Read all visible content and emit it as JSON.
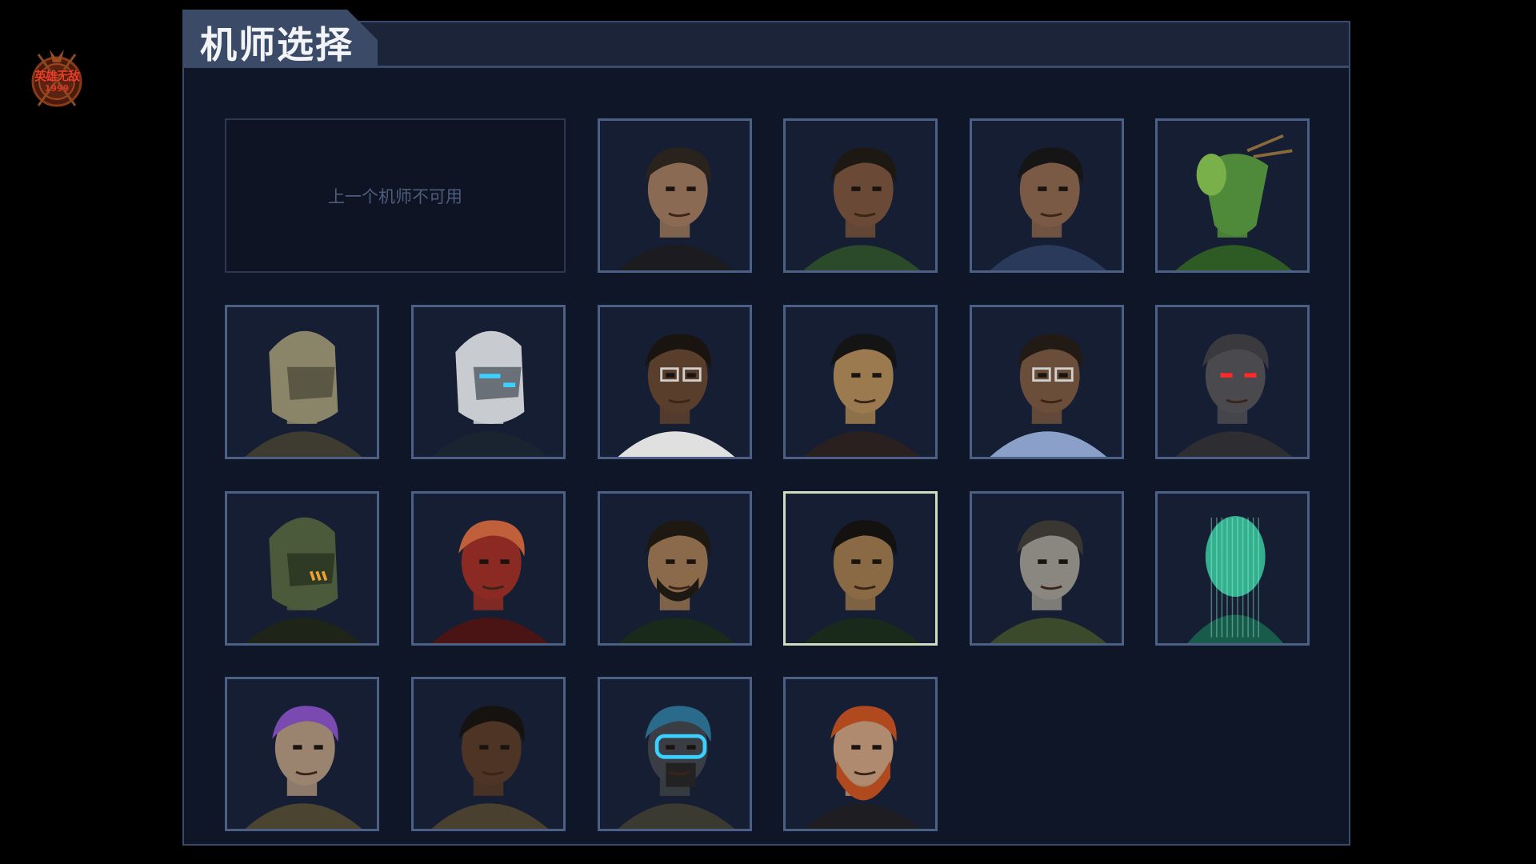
{
  "screen": {
    "title": "机师选择",
    "unavailable_label": "上一个机师不可用",
    "logo_text": "英雄无敌",
    "logo_year": "1999"
  },
  "pilots": [
    {
      "icon": "older-man-stubble-portrait-icon",
      "selected": false
    },
    {
      "icon": "young-woman-portrait-icon",
      "selected": false
    },
    {
      "icon": "curly-haired-youth-portrait-icon",
      "selected": false
    },
    {
      "icon": "mantis-alien-portrait-icon",
      "selected": false
    },
    {
      "icon": "tan-helmet-portrait-icon",
      "selected": false
    },
    {
      "icon": "white-cyan-helmet-portrait-icon",
      "selected": false
    },
    {
      "icon": "man-glasses-portrait-icon",
      "selected": false
    },
    {
      "icon": "smiling-man-portrait-icon",
      "selected": false
    },
    {
      "icon": "woman-glasses-portrait-icon",
      "selected": false
    },
    {
      "icon": "stone-golem-red-eyes-portrait-icon",
      "selected": false
    },
    {
      "icon": "green-insect-helmet-portrait-icon",
      "selected": false
    },
    {
      "icon": "red-armored-helmet-portrait-icon",
      "selected": false
    },
    {
      "icon": "bearded-scarred-man-portrait-icon",
      "selected": false
    },
    {
      "icon": "smiling-woman-portrait-icon",
      "selected": true
    },
    {
      "icon": "elderly-man-portrait-icon",
      "selected": false
    },
    {
      "icon": "green-hologram-portrait-icon",
      "selected": false
    },
    {
      "icon": "purple-mohawk-portrait-icon",
      "selected": false
    },
    {
      "icon": "dark-curly-hair-woman-portrait-icon",
      "selected": false
    },
    {
      "icon": "cyber-mask-goggles-portrait-icon",
      "selected": false
    },
    {
      "icon": "red-bearded-man-portrait-icon",
      "selected": false
    }
  ],
  "colors": {
    "panel_bg": "#0f1627",
    "slot_border": "#4c5f84",
    "selected_border": "#cfdcc0",
    "title_tab": "#3b4a66"
  }
}
